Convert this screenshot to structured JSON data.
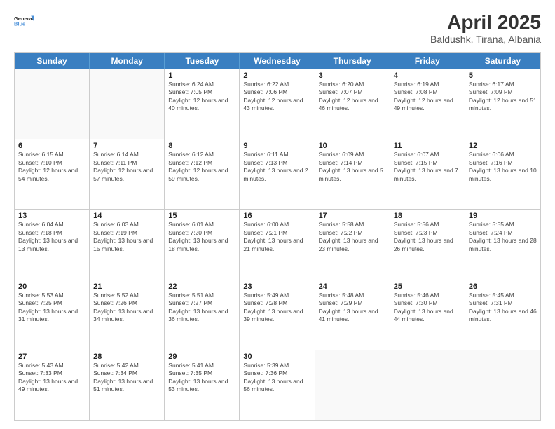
{
  "logo": {
    "line1": "General",
    "line2": "Blue"
  },
  "title": {
    "month_year": "April 2025",
    "location": "Baldushk, Tirana, Albania"
  },
  "calendar": {
    "headers": [
      "Sunday",
      "Monday",
      "Tuesday",
      "Wednesday",
      "Thursday",
      "Friday",
      "Saturday"
    ],
    "rows": [
      [
        {
          "day": "",
          "sunrise": "",
          "sunset": "",
          "daylight": ""
        },
        {
          "day": "",
          "sunrise": "",
          "sunset": "",
          "daylight": ""
        },
        {
          "day": "1",
          "sunrise": "Sunrise: 6:24 AM",
          "sunset": "Sunset: 7:05 PM",
          "daylight": "Daylight: 12 hours and 40 minutes."
        },
        {
          "day": "2",
          "sunrise": "Sunrise: 6:22 AM",
          "sunset": "Sunset: 7:06 PM",
          "daylight": "Daylight: 12 hours and 43 minutes."
        },
        {
          "day": "3",
          "sunrise": "Sunrise: 6:20 AM",
          "sunset": "Sunset: 7:07 PM",
          "daylight": "Daylight: 12 hours and 46 minutes."
        },
        {
          "day": "4",
          "sunrise": "Sunrise: 6:19 AM",
          "sunset": "Sunset: 7:08 PM",
          "daylight": "Daylight: 12 hours and 49 minutes."
        },
        {
          "day": "5",
          "sunrise": "Sunrise: 6:17 AM",
          "sunset": "Sunset: 7:09 PM",
          "daylight": "Daylight: 12 hours and 51 minutes."
        }
      ],
      [
        {
          "day": "6",
          "sunrise": "Sunrise: 6:15 AM",
          "sunset": "Sunset: 7:10 PM",
          "daylight": "Daylight: 12 hours and 54 minutes."
        },
        {
          "day": "7",
          "sunrise": "Sunrise: 6:14 AM",
          "sunset": "Sunset: 7:11 PM",
          "daylight": "Daylight: 12 hours and 57 minutes."
        },
        {
          "day": "8",
          "sunrise": "Sunrise: 6:12 AM",
          "sunset": "Sunset: 7:12 PM",
          "daylight": "Daylight: 12 hours and 59 minutes."
        },
        {
          "day": "9",
          "sunrise": "Sunrise: 6:11 AM",
          "sunset": "Sunset: 7:13 PM",
          "daylight": "Daylight: 13 hours and 2 minutes."
        },
        {
          "day": "10",
          "sunrise": "Sunrise: 6:09 AM",
          "sunset": "Sunset: 7:14 PM",
          "daylight": "Daylight: 13 hours and 5 minutes."
        },
        {
          "day": "11",
          "sunrise": "Sunrise: 6:07 AM",
          "sunset": "Sunset: 7:15 PM",
          "daylight": "Daylight: 13 hours and 7 minutes."
        },
        {
          "day": "12",
          "sunrise": "Sunrise: 6:06 AM",
          "sunset": "Sunset: 7:16 PM",
          "daylight": "Daylight: 13 hours and 10 minutes."
        }
      ],
      [
        {
          "day": "13",
          "sunrise": "Sunrise: 6:04 AM",
          "sunset": "Sunset: 7:18 PM",
          "daylight": "Daylight: 13 hours and 13 minutes."
        },
        {
          "day": "14",
          "sunrise": "Sunrise: 6:03 AM",
          "sunset": "Sunset: 7:19 PM",
          "daylight": "Daylight: 13 hours and 15 minutes."
        },
        {
          "day": "15",
          "sunrise": "Sunrise: 6:01 AM",
          "sunset": "Sunset: 7:20 PM",
          "daylight": "Daylight: 13 hours and 18 minutes."
        },
        {
          "day": "16",
          "sunrise": "Sunrise: 6:00 AM",
          "sunset": "Sunset: 7:21 PM",
          "daylight": "Daylight: 13 hours and 21 minutes."
        },
        {
          "day": "17",
          "sunrise": "Sunrise: 5:58 AM",
          "sunset": "Sunset: 7:22 PM",
          "daylight": "Daylight: 13 hours and 23 minutes."
        },
        {
          "day": "18",
          "sunrise": "Sunrise: 5:56 AM",
          "sunset": "Sunset: 7:23 PM",
          "daylight": "Daylight: 13 hours and 26 minutes."
        },
        {
          "day": "19",
          "sunrise": "Sunrise: 5:55 AM",
          "sunset": "Sunset: 7:24 PM",
          "daylight": "Daylight: 13 hours and 28 minutes."
        }
      ],
      [
        {
          "day": "20",
          "sunrise": "Sunrise: 5:53 AM",
          "sunset": "Sunset: 7:25 PM",
          "daylight": "Daylight: 13 hours and 31 minutes."
        },
        {
          "day": "21",
          "sunrise": "Sunrise: 5:52 AM",
          "sunset": "Sunset: 7:26 PM",
          "daylight": "Daylight: 13 hours and 34 minutes."
        },
        {
          "day": "22",
          "sunrise": "Sunrise: 5:51 AM",
          "sunset": "Sunset: 7:27 PM",
          "daylight": "Daylight: 13 hours and 36 minutes."
        },
        {
          "day": "23",
          "sunrise": "Sunrise: 5:49 AM",
          "sunset": "Sunset: 7:28 PM",
          "daylight": "Daylight: 13 hours and 39 minutes."
        },
        {
          "day": "24",
          "sunrise": "Sunrise: 5:48 AM",
          "sunset": "Sunset: 7:29 PM",
          "daylight": "Daylight: 13 hours and 41 minutes."
        },
        {
          "day": "25",
          "sunrise": "Sunrise: 5:46 AM",
          "sunset": "Sunset: 7:30 PM",
          "daylight": "Daylight: 13 hours and 44 minutes."
        },
        {
          "day": "26",
          "sunrise": "Sunrise: 5:45 AM",
          "sunset": "Sunset: 7:31 PM",
          "daylight": "Daylight: 13 hours and 46 minutes."
        }
      ],
      [
        {
          "day": "27",
          "sunrise": "Sunrise: 5:43 AM",
          "sunset": "Sunset: 7:33 PM",
          "daylight": "Daylight: 13 hours and 49 minutes."
        },
        {
          "day": "28",
          "sunrise": "Sunrise: 5:42 AM",
          "sunset": "Sunset: 7:34 PM",
          "daylight": "Daylight: 13 hours and 51 minutes."
        },
        {
          "day": "29",
          "sunrise": "Sunrise: 5:41 AM",
          "sunset": "Sunset: 7:35 PM",
          "daylight": "Daylight: 13 hours and 53 minutes."
        },
        {
          "day": "30",
          "sunrise": "Sunrise: 5:39 AM",
          "sunset": "Sunset: 7:36 PM",
          "daylight": "Daylight: 13 hours and 56 minutes."
        },
        {
          "day": "",
          "sunrise": "",
          "sunset": "",
          "daylight": ""
        },
        {
          "day": "",
          "sunrise": "",
          "sunset": "",
          "daylight": ""
        },
        {
          "day": "",
          "sunrise": "",
          "sunset": "",
          "daylight": ""
        }
      ]
    ]
  }
}
